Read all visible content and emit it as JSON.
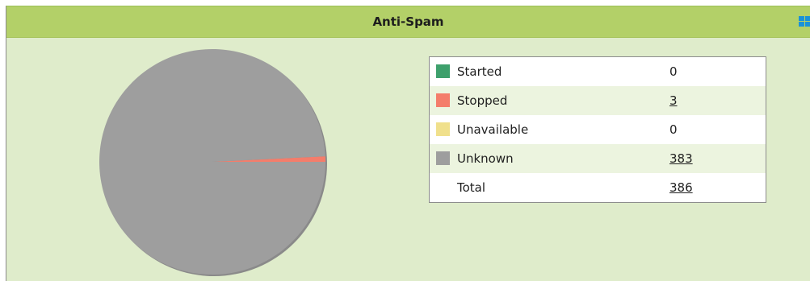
{
  "widget": {
    "title": "Anti-Spam",
    "header_color": "#b3d068",
    "panel_color": "#dfeccb",
    "icon": "windows-icon"
  },
  "chart_data": {
    "type": "pie",
    "title": "Anti-Spam",
    "categories": [
      "Started",
      "Stopped",
      "Unavailable",
      "Unknown"
    ],
    "values": [
      0,
      3,
      0,
      383
    ],
    "colors": [
      "#3ea06c",
      "#f47d6b",
      "#f0e08c",
      "#9e9e9e"
    ],
    "total": 386
  },
  "legend": {
    "rows": [
      {
        "label": "Started",
        "value": "0",
        "linked": false,
        "color": "#3ea06c"
      },
      {
        "label": "Stopped",
        "value": "3",
        "linked": true,
        "color": "#f47d6b"
      },
      {
        "label": "Unavailable",
        "value": "0",
        "linked": false,
        "color": "#f0e08c"
      },
      {
        "label": "Unknown",
        "value": "383",
        "linked": true,
        "color": "#9e9e9e"
      }
    ],
    "total_label": "Total",
    "total_value": "386"
  }
}
